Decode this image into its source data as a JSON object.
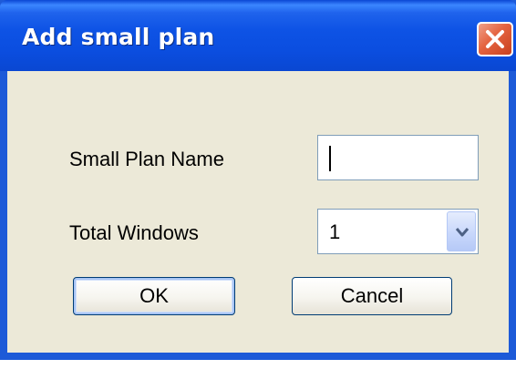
{
  "window": {
    "title": "Add small plan",
    "close_icon": "close-icon",
    "colors": {
      "titlebar": "#0b4ee0",
      "body": "#ece9d8",
      "close_button": "#e4633f"
    }
  },
  "form": {
    "name_label": "Small Plan Name",
    "name_value": "",
    "windows_label": "Total Windows",
    "windows_value": "1",
    "windows_dropdown_icon": "chevron-down-icon"
  },
  "buttons": {
    "ok_label": "OK",
    "cancel_label": "Cancel"
  }
}
